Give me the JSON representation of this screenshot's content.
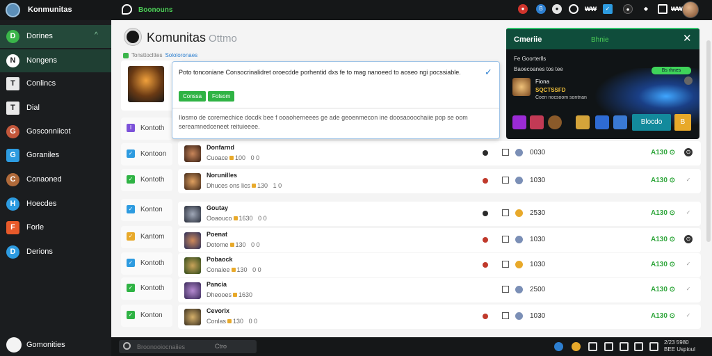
{
  "topbar": {
    "app_title": "Konmunitas",
    "workspace_label": "Boonouns",
    "indicator_values": [
      "₩₩",
      "₩₩"
    ],
    "icons": [
      "app-logo-icon",
      "chat-icon",
      "alert-icon",
      "info-icon",
      "search-icon",
      "twitter-icon",
      "mask-icon",
      "bell-icon",
      "screen-icon",
      "profile-avatar"
    ]
  },
  "sidebar": {
    "items": [
      {
        "label": "Dorines",
        "icon": "D"
      },
      {
        "label": "Nongens",
        "icon": "N"
      },
      {
        "label": "Conlincs",
        "icon": "T"
      },
      {
        "label": "Dial",
        "icon": "T"
      },
      {
        "label": "Gosconniicot",
        "icon": "G"
      },
      {
        "label": "Goraniles",
        "icon": "G"
      },
      {
        "label": "Conaoned",
        "icon": "C"
      },
      {
        "label": "Hoecdes",
        "icon": "H"
      },
      {
        "label": "Forle",
        "icon": "F"
      },
      {
        "label": "Derions",
        "icon": "D"
      }
    ],
    "footer_label": "Gomonities"
  },
  "main": {
    "title": "Komunitas",
    "title_suffix": "Ottmo",
    "crumb_text": "Tonsttoclttes",
    "crumb_link": "Sololoronaes",
    "left_items": [
      {
        "label": "Kontoth",
        "color": "#7c52d9"
      },
      {
        "label": "Kontoon",
        "color": "#2d9be0"
      },
      {
        "label": "Kontoth",
        "color": "#2fb344"
      },
      {
        "label": "Konton",
        "color": "#2d9be0"
      },
      {
        "label": "Kantom",
        "color": "#e8a92a"
      },
      {
        "label": "Kontoth",
        "color": "#2d9be0"
      },
      {
        "label": "Kontoth",
        "color": "#2fb344"
      },
      {
        "label": "Konton",
        "color": "#2fb344"
      }
    ],
    "rows": [
      {
        "name": "Donfarnd",
        "meta": "Cuoace",
        "meta_num": "100",
        "count": "0 0",
        "dot": "#2b2b2b",
        "ci": "#7b8fb6",
        "value": "0030",
        "price": "A130 ⊙",
        "action_color": "#333"
      },
      {
        "name": "Norunilles",
        "meta": "Dhuces ons lics",
        "meta_num": "130",
        "count": "1 0",
        "dot": "#c0392b",
        "ci": "#7b8fb6",
        "value": "1030",
        "price": "A130 ⊙",
        "action_color": "#999"
      },
      {
        "name": "Goutay",
        "meta": "Ooaouco",
        "meta_num": "1630",
        "count": "0 0",
        "dot": "#2b2b2b",
        "ci": "#e8a92a",
        "value": "2530",
        "price": "A130 ⊙",
        "action_color": "#999"
      },
      {
        "name": "Poenat",
        "meta": "Dotome",
        "meta_num": "130",
        "count": "0 0",
        "dot": "#c0392b",
        "ci": "#7b8fb6",
        "value": "1030",
        "price": "A130 ⊙",
        "action_color": "#333"
      },
      {
        "name": "Pobaock",
        "meta": "Conaiee",
        "meta_num": "130",
        "count": "0 0",
        "dot": "#c0392b",
        "ci": "#e8a92a",
        "value": "1030",
        "price": "A130 ⊙",
        "action_color": "#999"
      },
      {
        "name": "Pancia",
        "meta": "Dheooes",
        "meta_num": "1630",
        "count": "",
        "dot": "",
        "ci": "#7b8fb6",
        "value": "2500",
        "price": "A130 ⊙",
        "action_color": "#999"
      },
      {
        "name": "Cevorix",
        "meta": "Conlas",
        "meta_num": "130",
        "count": "0 0",
        "dot": "#c0392b",
        "ci": "#7b8fb6",
        "value": "1030",
        "price": "A130 ⊙",
        "action_color": "#999"
      }
    ]
  },
  "popover": {
    "text": "Poto tonconiane Consocrinalidret oroecdde porhentid dxs fe to mag nanoeed to aoseo ngi pocssiable.",
    "buttons": [
      "Conssa",
      "Folsom"
    ],
    "description": "Ilosmo de coremechice docdk bee f ooaoherneees ge ade geoenmecon ine doosaooochaiie pop se oom sereamnedceneet reituieeee."
  },
  "game_panel": {
    "title": "Cmeriie",
    "subtitle": "Bhnie",
    "line1": "Fe Goorterlls",
    "line2": "Baoecoanes tos tee",
    "badge": "Bs rhnes",
    "hero_name": "Fiona",
    "hero_status": "SQCTSSFD",
    "hero_sub": "Coen nocsoom sontnan",
    "play_label": "Blocdo",
    "coin_label": "B"
  },
  "bottombar": {
    "search_placeholder": "Broonooiocnaiies",
    "search_key": "Ctro",
    "status_text_1": "2/23 5980",
    "status_text_2": "BEE Uspioul"
  }
}
